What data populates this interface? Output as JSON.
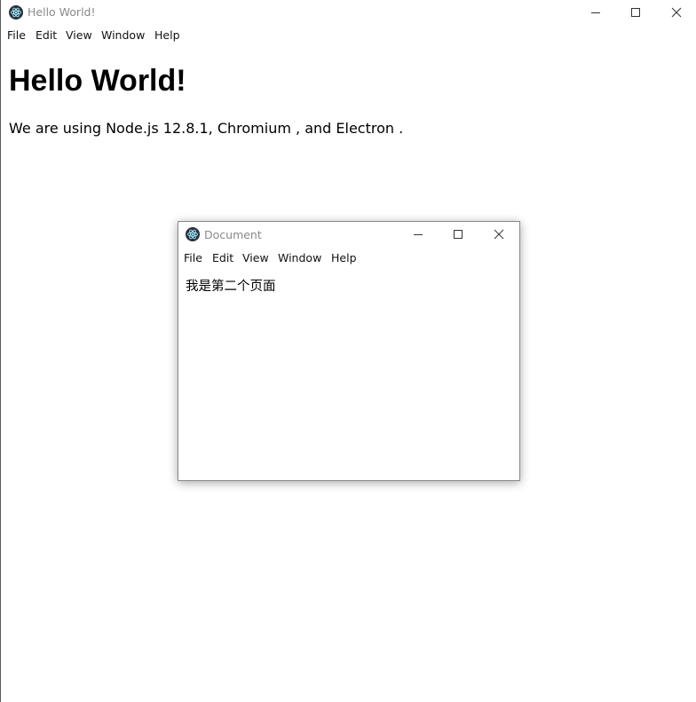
{
  "main_window": {
    "title": "Hello World!",
    "menu": [
      "File",
      "Edit",
      "View",
      "Window",
      "Help"
    ],
    "heading": "Hello World!",
    "paragraph": "We are using Node.js 12.8.1, Chromium , and Electron ."
  },
  "child_window": {
    "title": "Document",
    "menu": [
      "File",
      "Edit",
      "View",
      "Window",
      "Help"
    ],
    "content": "我是第二个页面"
  },
  "icons": {
    "app": "electron-app-icon",
    "minimize": "minimize-icon",
    "maximize": "maximize-icon",
    "close": "close-icon"
  },
  "colors": {
    "title_text": "#8a8a8a",
    "app_icon_bg": "#2b2e3b",
    "app_icon_fg": "#9feaf9"
  }
}
